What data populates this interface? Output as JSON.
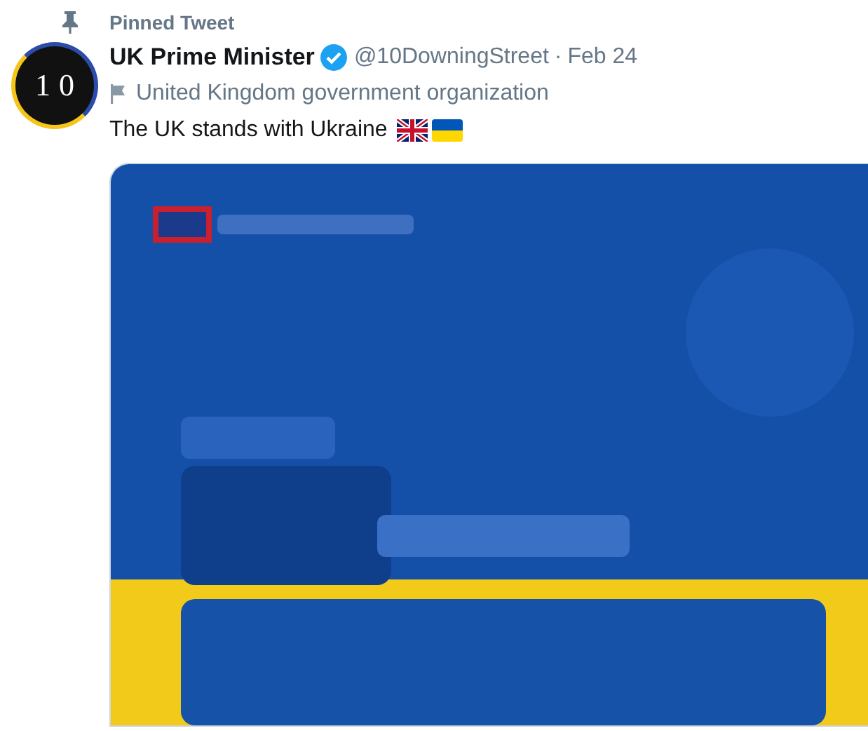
{
  "pinned_label": "Pinned Tweet",
  "tweet": {
    "avatar_text": "10",
    "name": "UK Prime Minister",
    "verified": true,
    "handle": "@10DowningStreet",
    "separator": "·",
    "date": "Feb 24",
    "label": "United Kingdom government organization",
    "text": "The UK stands with Ukraine"
  }
}
